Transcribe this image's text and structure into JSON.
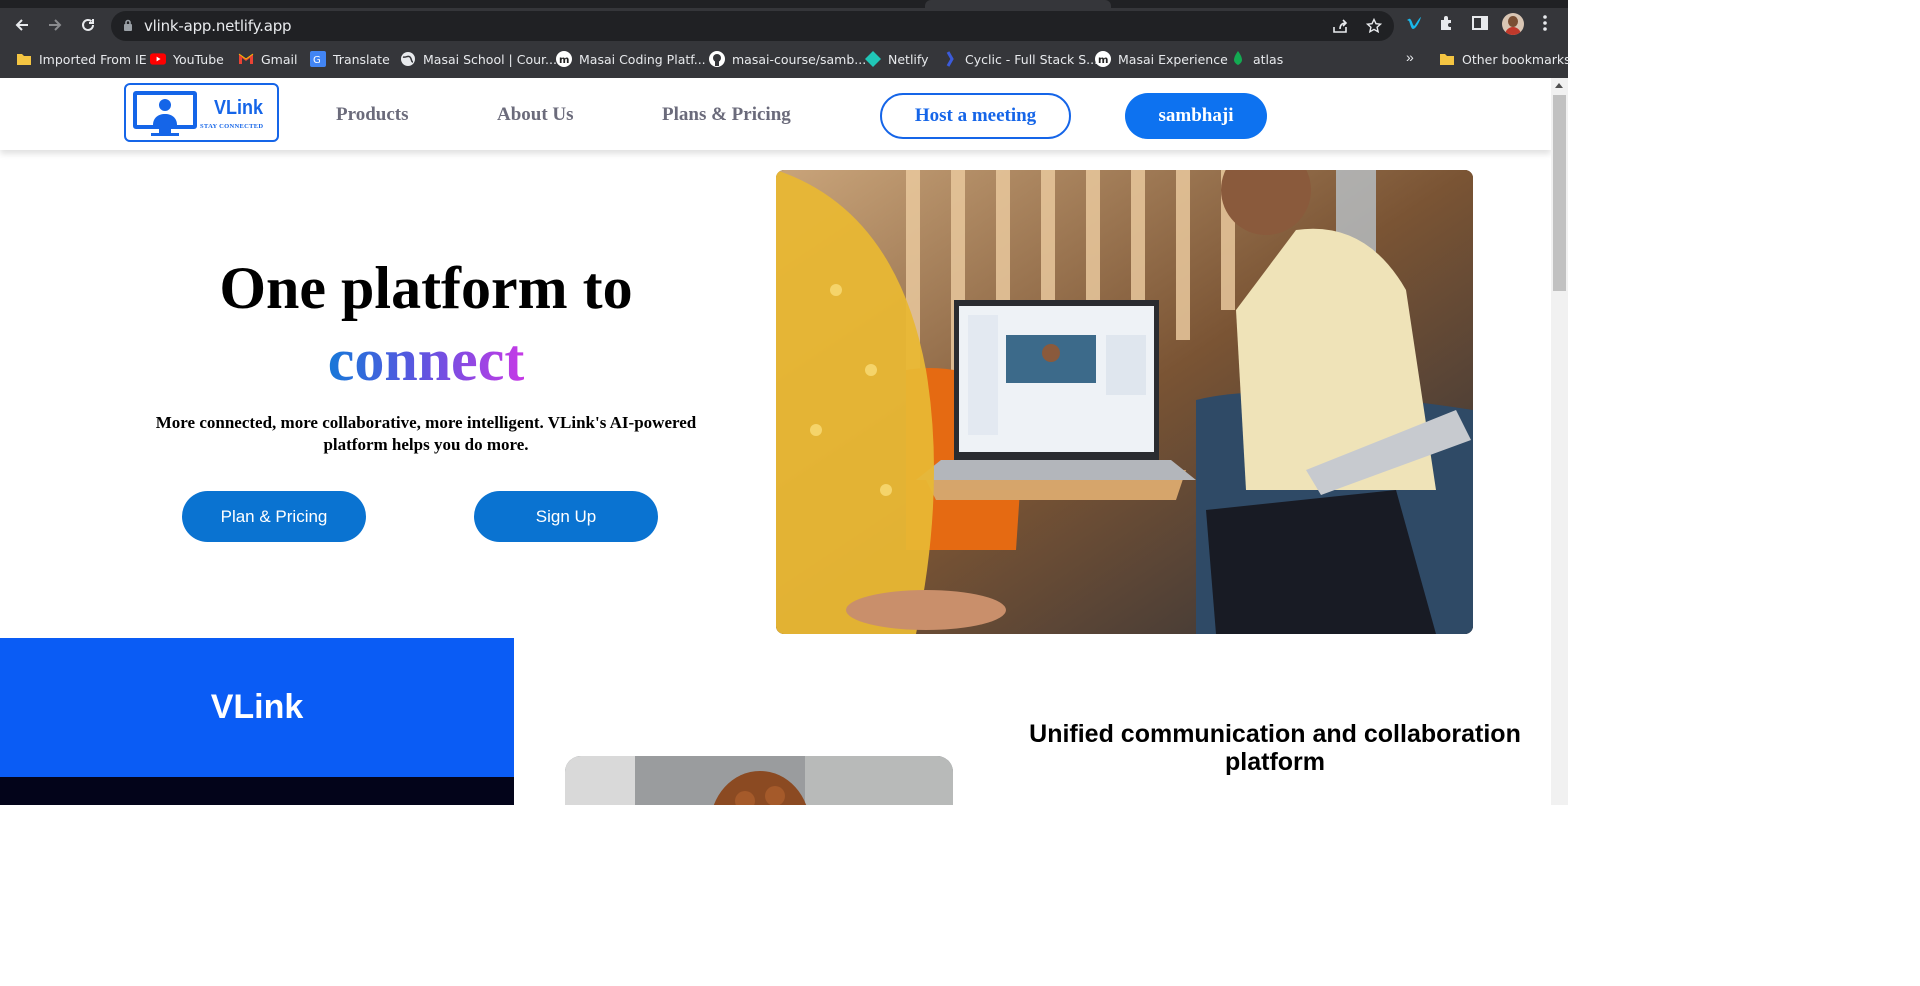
{
  "browser": {
    "url": "vlink-app.netlify.app",
    "bookmarks": [
      {
        "label": "Imported From IE",
        "icon": "folder-icon"
      },
      {
        "label": "YouTube",
        "icon": "youtube-icon"
      },
      {
        "label": "Gmail",
        "icon": "gmail-icon"
      },
      {
        "label": "Translate",
        "icon": "translate-icon"
      },
      {
        "label": "Masai School | Cour...",
        "icon": "globe-icon"
      },
      {
        "label": "Masai Coding Platf...",
        "icon": "masai-icon"
      },
      {
        "label": "masai-course/samb...",
        "icon": "github-icon"
      },
      {
        "label": "Netlify",
        "icon": "netlify-icon"
      },
      {
        "label": "Cyclic - Full Stack S...",
        "icon": "cyclic-icon"
      },
      {
        "label": "Masai Experience",
        "icon": "masai-icon"
      },
      {
        "label": "atlas",
        "icon": "mongodb-icon"
      }
    ],
    "more": "»",
    "other_bookmarks": "Other bookmarks"
  },
  "site": {
    "logo": {
      "brand": "VLink",
      "tagline": "STAY CONNECTED"
    },
    "nav": [
      {
        "label": "Products"
      },
      {
        "label": "About Us"
      },
      {
        "label": "Plans & Pricing"
      }
    ],
    "host_button": "Host a meeting",
    "user_button": "sambhaji"
  },
  "hero": {
    "title_line1": "One platform to",
    "title_highlight": "connect",
    "subtitle": "More connected, more collaborative, more intelligent. VLink's AI-powered platform helps you do more.",
    "primary_button": "Plan & Pricing",
    "secondary_button": "Sign Up"
  },
  "section2": {
    "band_title": "VLink",
    "heading": "Unified communication and collaboration platform"
  },
  "colors": {
    "brand_blue": "#1565e8",
    "button_blue": "#0a73d1",
    "band_blue": "#0a5cf5",
    "gradient": [
      "#1778d8",
      "#5a56e0",
      "#c63ae6"
    ]
  }
}
